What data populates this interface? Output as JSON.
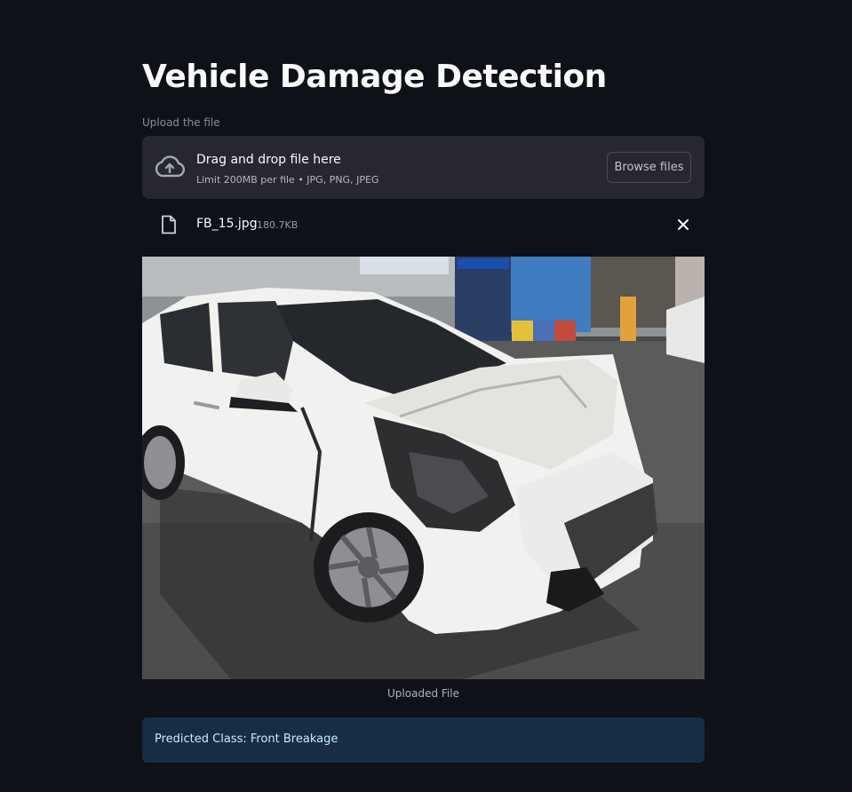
{
  "page": {
    "title": "Vehicle Damage Detection"
  },
  "uploader": {
    "label": "Upload the file",
    "drop_text": "Drag and drop file here",
    "limit_text": "Limit 200MB per file • JPG, PNG, JPEG",
    "browse_label": "Browse files",
    "icon": "cloud-upload-icon"
  },
  "uploaded_file": {
    "name": "FB_15.jpg",
    "size": "180.7KB",
    "icon": "file-icon",
    "remove_icon": "close-icon"
  },
  "image": {
    "caption": "Uploaded File"
  },
  "result": {
    "text": "Predicted Class: Front Breakage"
  },
  "colors": {
    "background": "#0e1117",
    "dropzone": "#262730",
    "result_bg": "#172d43",
    "result_text": "#c7ebff"
  }
}
